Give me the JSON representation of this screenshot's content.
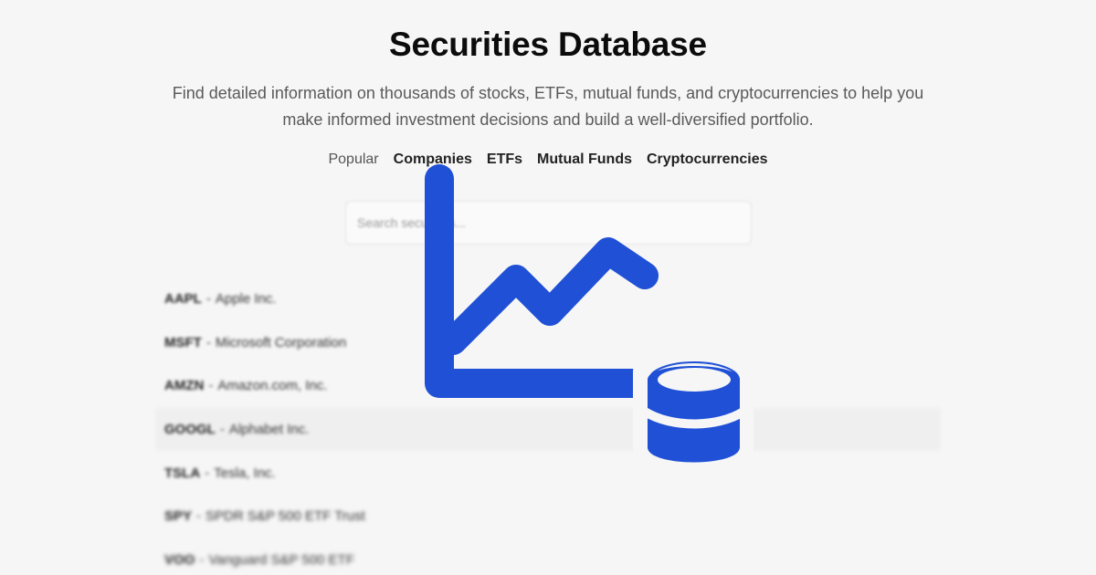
{
  "header": {
    "title": "Securities Database",
    "subtitle": "Find detailed information on thousands of stocks, ETFs, mutual funds, and cryptocurrencies to help you make informed investment decisions and build a well-diversified portfolio."
  },
  "tabs": [
    {
      "label": "Popular"
    },
    {
      "label": "Companies"
    },
    {
      "label": "ETFs"
    },
    {
      "label": "Mutual Funds"
    },
    {
      "label": "Cryptocurrencies"
    }
  ],
  "search": {
    "placeholder": "Search securities..."
  },
  "securities": [
    {
      "ticker": "AAPL",
      "name": "Apple Inc."
    },
    {
      "ticker": "MSFT",
      "name": "Microsoft Corporation"
    },
    {
      "ticker": "AMZN",
      "name": "Amazon.com, Inc."
    },
    {
      "ticker": "GOOGL",
      "name": "Alphabet Inc."
    },
    {
      "ticker": "TSLA",
      "name": "Tesla, Inc."
    },
    {
      "ticker": "SPY",
      "name": "SPDR S&P 500 ETF Trust"
    },
    {
      "ticker": "VOO",
      "name": "Vanguard S&P 500 ETF"
    }
  ],
  "colors": {
    "accent": "#1f50d6",
    "background": "#f6f6f6"
  },
  "logo": {
    "icon": "chart-database-icon"
  }
}
